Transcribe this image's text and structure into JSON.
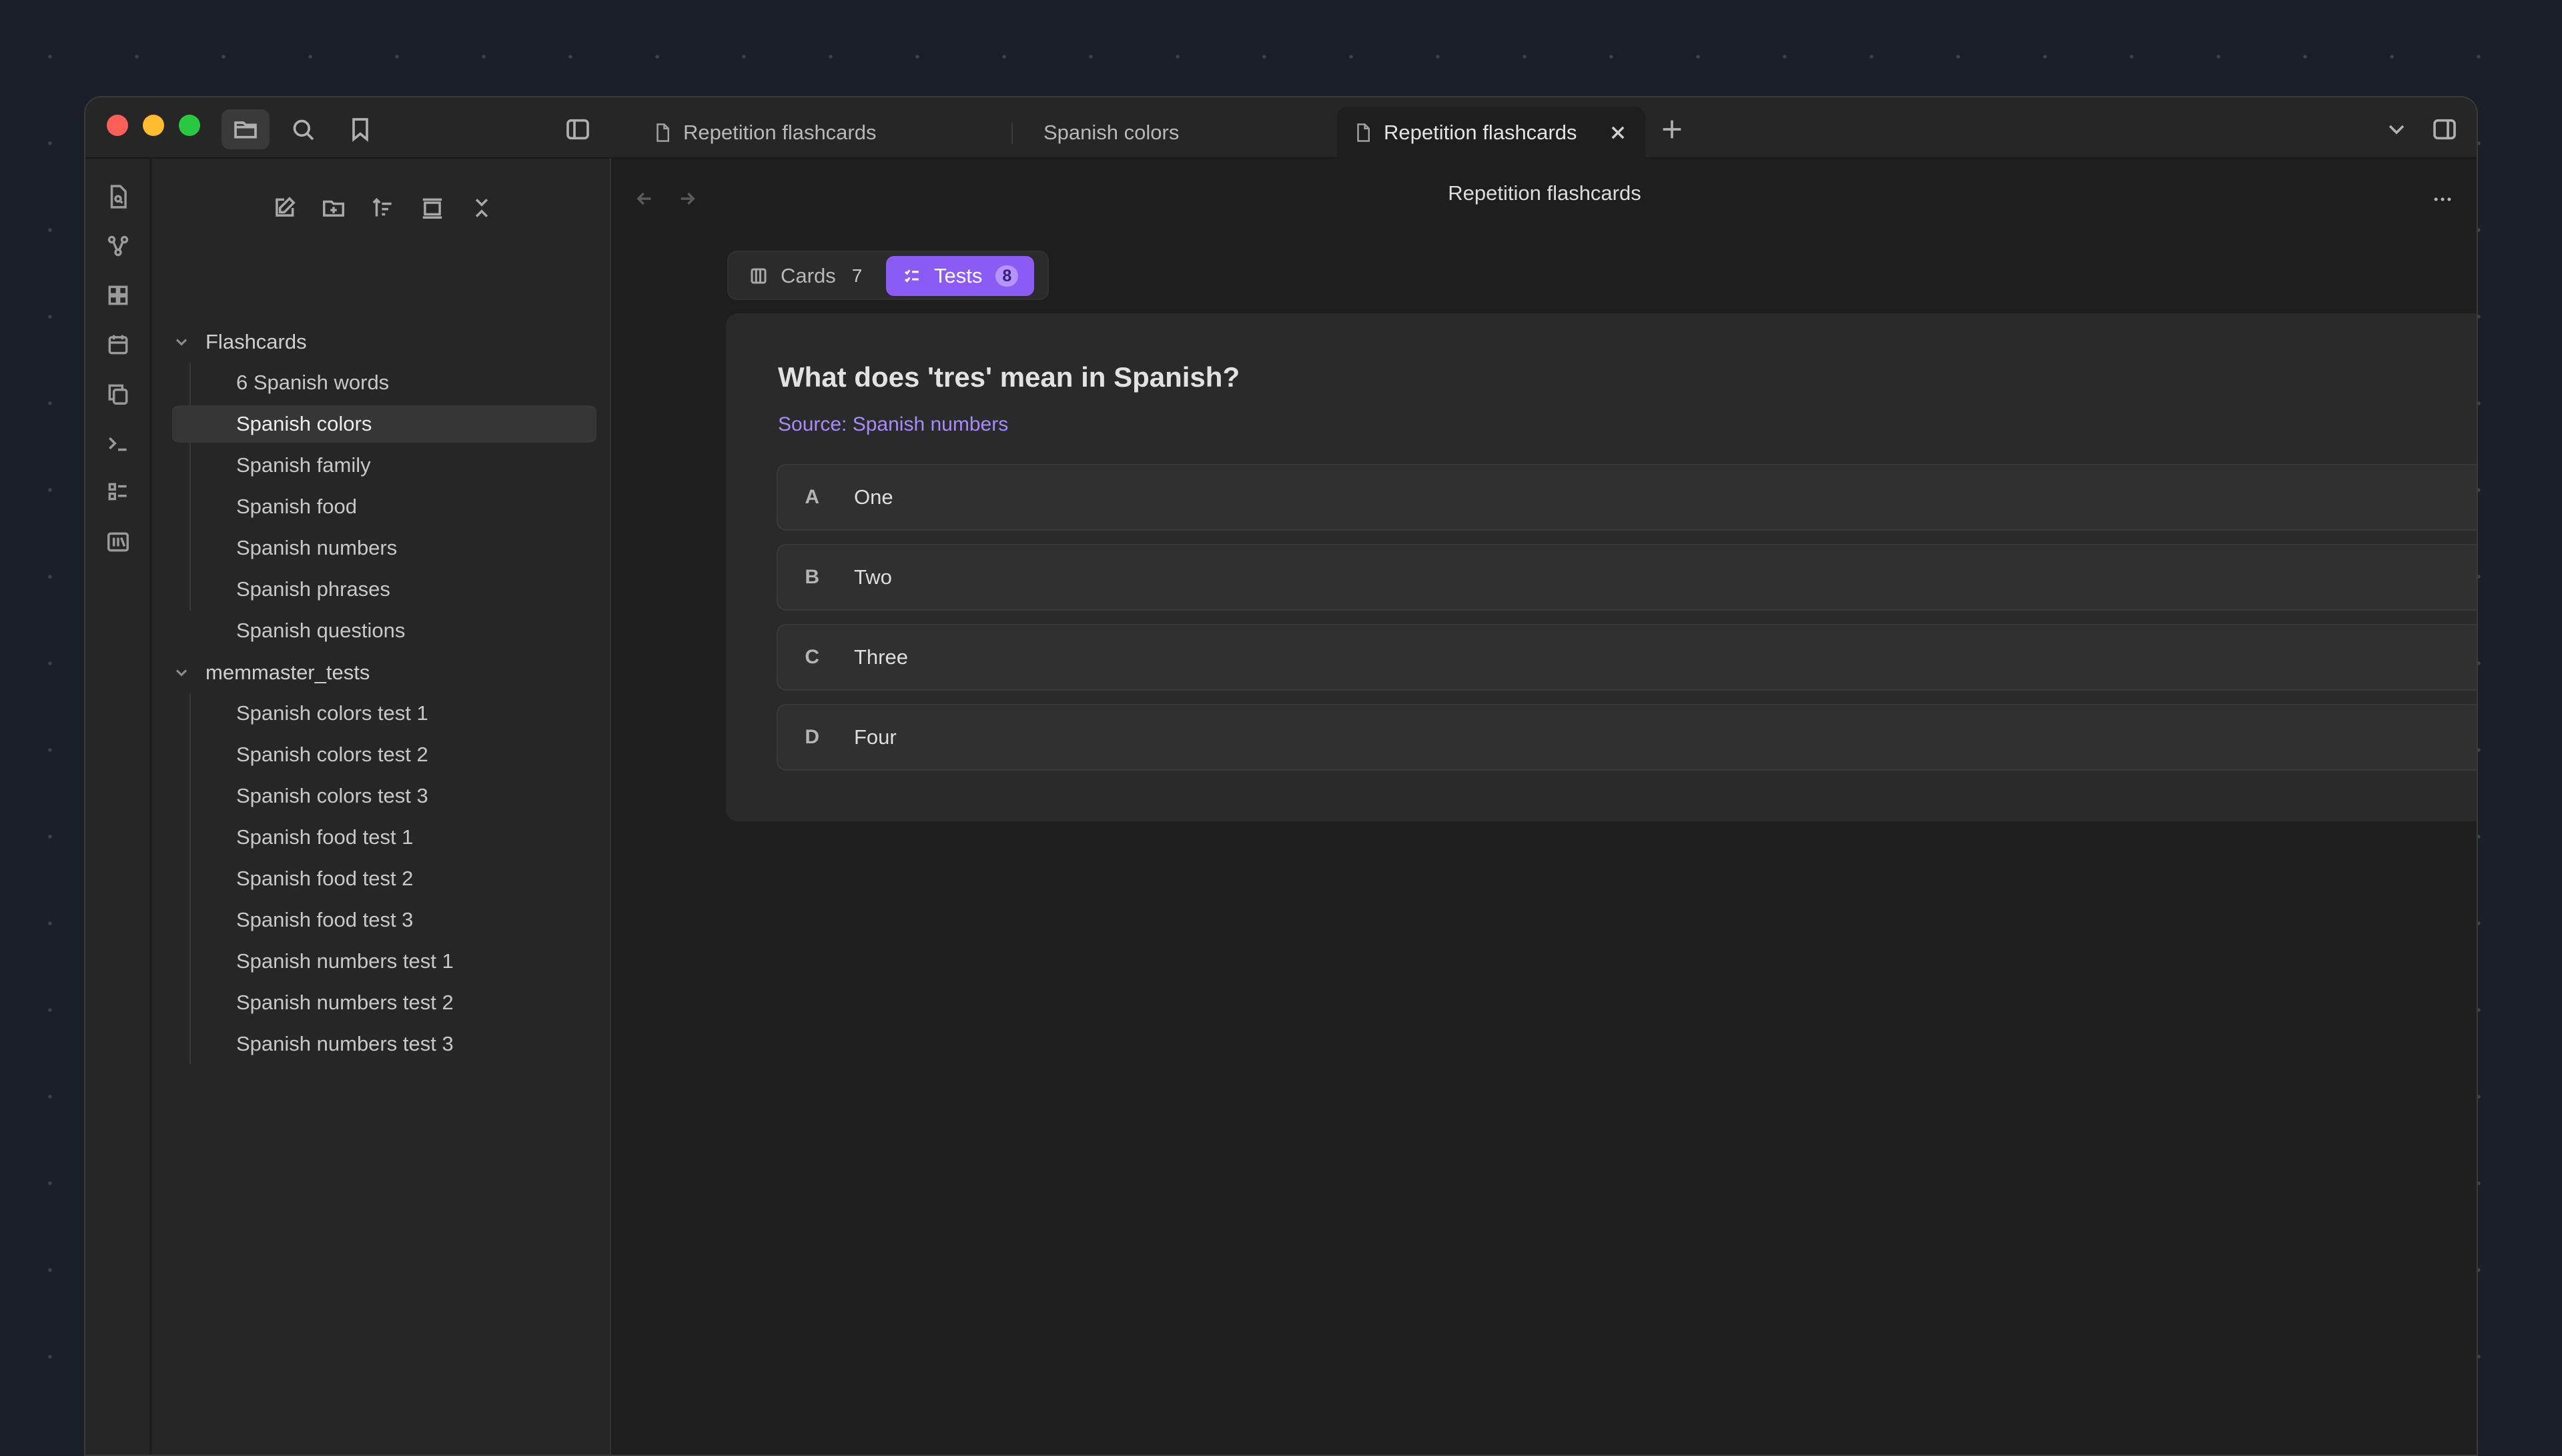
{
  "titlebar": {
    "tabs": [
      {
        "label": "Repetition flashcards"
      },
      {
        "label": "Spanish colors"
      },
      {
        "label": "Repetition flashcards"
      }
    ]
  },
  "sidebar": {
    "folders": [
      {
        "name": "Flashcards",
        "files": [
          "6 Spanish words",
          "Spanish colors",
          "Spanish family",
          "Spanish food",
          "Spanish numbers",
          "Spanish phrases",
          "Spanish questions"
        ]
      },
      {
        "name": "memmaster_tests",
        "files": [
          "Spanish colors test 1",
          "Spanish colors test 2",
          "Spanish colors test 3",
          "Spanish food test 1",
          "Spanish food test 2",
          "Spanish food test 3",
          "Spanish numbers test 1",
          "Spanish numbers test 2",
          "Spanish numbers test 3"
        ]
      }
    ],
    "selected_file": "Spanish colors"
  },
  "main": {
    "view_title": "Repetition flashcards",
    "segments": {
      "cards": {
        "label": "Cards",
        "count": "7"
      },
      "tests": {
        "label": "Tests",
        "count": "8",
        "active": true
      }
    },
    "quiz": {
      "question": "What does 'tres' mean in Spanish?",
      "source": "Source: Spanish numbers",
      "options": [
        {
          "letter": "A",
          "text": "One"
        },
        {
          "letter": "B",
          "text": "Two"
        },
        {
          "letter": "C",
          "text": "Three"
        },
        {
          "letter": "D",
          "text": "Four"
        }
      ]
    }
  },
  "colors": {
    "accent": "#8a5cf5",
    "source_link": "#a78bfa"
  }
}
